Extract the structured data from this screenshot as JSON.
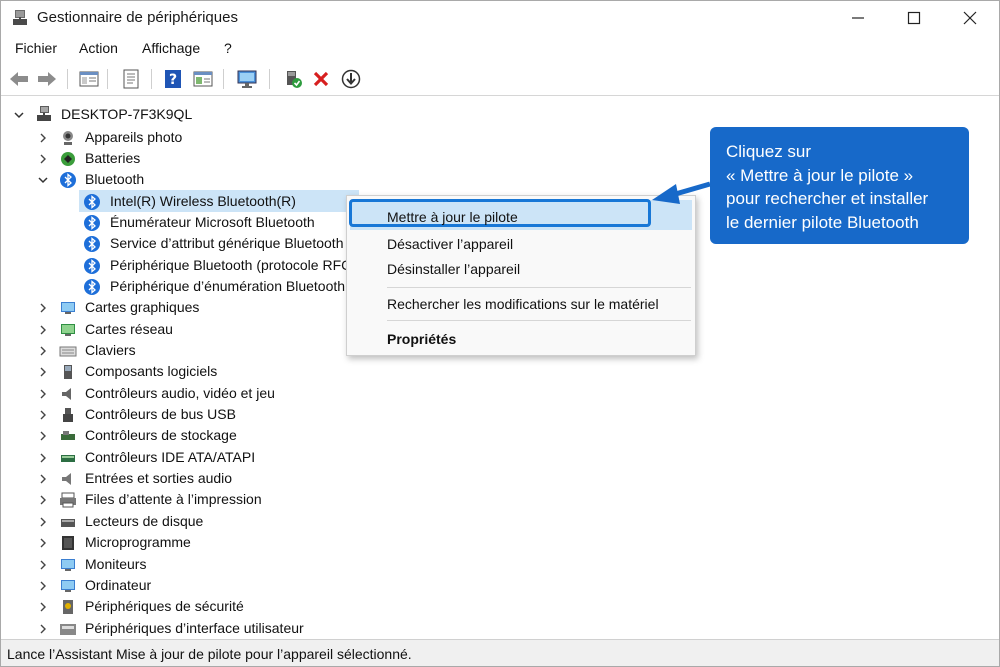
{
  "window": {
    "title": "Gestionnaire de périphériques",
    "controls": [
      "minimize",
      "maximize",
      "close"
    ]
  },
  "menu": [
    "Fichier",
    "Action",
    "Affichage",
    "?"
  ],
  "toolbar": {
    "icons": [
      "back-arrow-icon",
      "forward-arrow-icon",
      "properties-icon",
      "update-driver-icon",
      "help-icon",
      "view-icon",
      "monitor-icon",
      "enable-device-icon",
      "uninstall-x-icon",
      "download-driver-icon"
    ]
  },
  "tree": {
    "root": "DESKTOP-7F3K9QL",
    "items": [
      {
        "label": "Appareils photo",
        "expanded": false
      },
      {
        "label": "Batteries",
        "expanded": false
      },
      {
        "label": "Bluetooth",
        "expanded": true,
        "children": [
          "Intel(R) Wireless Bluetooth(R)",
          "Énumérateur Microsoft Bluetooth",
          "Service d’attribut générique Bluetooth",
          "Périphérique Bluetooth (protocole RFC",
          "Périphérique d’énumération Bluetooth"
        ]
      },
      {
        "label": "Cartes graphiques",
        "expanded": false
      },
      {
        "label": "Cartes réseau",
        "expanded": false
      },
      {
        "label": "Claviers",
        "expanded": false
      },
      {
        "label": "Composants logiciels",
        "expanded": false
      },
      {
        "label": "Contrôleurs audio, vidéo et jeu",
        "expanded": false
      },
      {
        "label": "Contrôleurs de bus USB",
        "expanded": false
      },
      {
        "label": "Contrôleurs de stockage",
        "expanded": false
      },
      {
        "label": "Contrôleurs IDE ATA/ATAPI",
        "expanded": false
      },
      {
        "label": "Entrées et sorties audio",
        "expanded": false
      },
      {
        "label": "Files d’attente à l’impression",
        "expanded": false
      },
      {
        "label": "Lecteurs de disque",
        "expanded": false
      },
      {
        "label": "Microprogramme",
        "expanded": false
      },
      {
        "label": "Moniteurs",
        "expanded": false
      },
      {
        "label": "Ordinateur",
        "expanded": false
      },
      {
        "label": "Périphériques de sécurité",
        "expanded": false
      },
      {
        "label": "Périphériques d’interface utilisateur",
        "expanded": false
      }
    ],
    "selected": "Intel(R) Wireless Bluetooth(R)"
  },
  "context_menu": {
    "items": [
      {
        "label": "Mettre à jour le pilote",
        "highlighted": true
      },
      {
        "label": "Désactiver l’appareil"
      },
      {
        "label": "Désinstaller l’appareil"
      },
      {
        "label": "Rechercher les modifications sur le matériel"
      },
      {
        "label": "Propriétés",
        "bold": true
      }
    ]
  },
  "callout": {
    "lines": [
      "Cliquez sur",
      "« Mettre à jour le pilote »",
      "pour rechercher et installer",
      "le dernier pilote Bluetooth"
    ],
    "color": "#1769c9"
  },
  "status": "Lance l’Assistant Mise à jour de pilote pour l’appareil sélectionné.",
  "colors": {
    "selection": "#cce4f7",
    "accent": "#1877d6",
    "bluetooth": "#1e6fd9"
  }
}
